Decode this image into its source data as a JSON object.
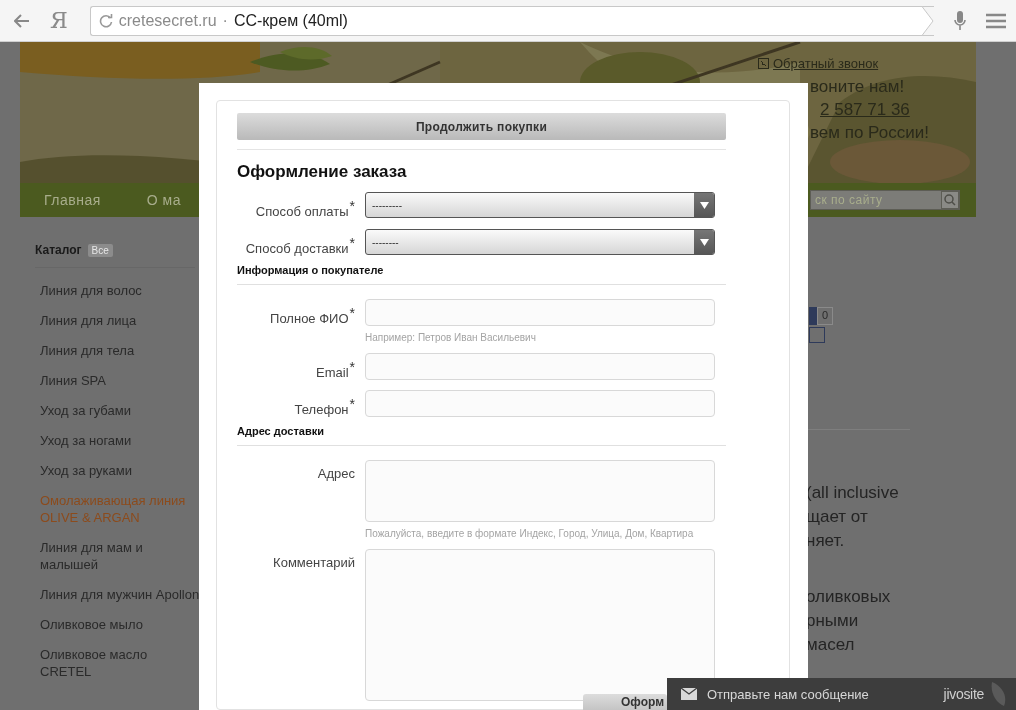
{
  "browser": {
    "logo": "Я",
    "domain": "cretesecret.ru",
    "separator": "·",
    "page_title": "CC-крем (40ml)"
  },
  "header": {
    "callback_link": "Обратный звонок",
    "call_text": "воните нам!",
    "phone": "2 587 71 36",
    "delivery_text": "вем по России!"
  },
  "nav": {
    "items": [
      {
        "label": "Главная"
      },
      {
        "label": "О ма"
      }
    ],
    "search": {
      "placeholder": "ск по сайту"
    }
  },
  "catalog": {
    "title": "Каталог",
    "badge": "Все",
    "items": [
      {
        "label": "Линия для волос",
        "selected": false
      },
      {
        "label": "Линия для лица",
        "selected": false
      },
      {
        "label": "Линия для тела",
        "selected": false
      },
      {
        "label": "Линия SPA",
        "selected": false
      },
      {
        "label": "Уход за губами",
        "selected": false
      },
      {
        "label": "Уход за ногами",
        "selected": false
      },
      {
        "label": "Уход за руками",
        "selected": false
      },
      {
        "label": "Омолаживающая линия OLIVE & ARGAN",
        "selected": true
      },
      {
        "label": "Линия для мам и малышей",
        "selected": false
      },
      {
        "label": "Линия для мужчин Apollon",
        "selected": false
      },
      {
        "label": "Оливковое мыло",
        "selected": false
      },
      {
        "label": "Оливковое масло CRETEL",
        "selected": false
      }
    ]
  },
  "content": {
    "counter": "0",
    "lines": [
      "(all inclusive",
      "щает от",
      "няет.",
      "оливковых",
      "рными",
      "масел"
    ]
  },
  "modal": {
    "continue_button": "Продолжить покупки",
    "title": "Оформление заказа",
    "fields": [
      {
        "kind": "select",
        "label": "Способ оплаты",
        "required_mark": "*",
        "value": "---------"
      },
      {
        "kind": "select",
        "label": "Способ доставки",
        "required_mark": "*",
        "value": "--------"
      },
      {
        "kind": "section",
        "label": "Информация о покупателе"
      },
      {
        "kind": "input",
        "label": "Полное ФИО",
        "required_mark": "*",
        "hint": "Например: Петров Иван Васильевич"
      },
      {
        "kind": "input",
        "label": "Email",
        "required_mark": "*"
      },
      {
        "kind": "input",
        "label": "Телефон",
        "required_mark": "*"
      },
      {
        "kind": "section",
        "label": "Адрес доставки"
      },
      {
        "kind": "textarea",
        "label": "Адрес",
        "hint": "Пожалуйста, введите в формате Индекс, Город, Улица, Дом, Квартира"
      },
      {
        "kind": "bigarea",
        "label": "Комментарий"
      }
    ],
    "submit_button": "Оформ"
  },
  "chat": {
    "label": "Отправьте нам сообщение",
    "brand": "jivosite"
  }
}
